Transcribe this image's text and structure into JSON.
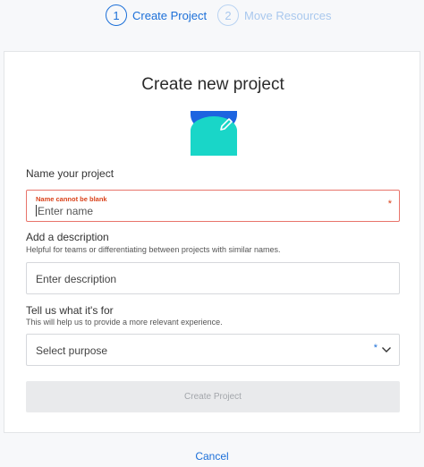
{
  "stepper": {
    "steps": [
      {
        "number": "1",
        "label": "Create Project"
      },
      {
        "number": "2",
        "label": "Move Resources"
      }
    ]
  },
  "card": {
    "title": "Create new project",
    "name_field": {
      "label": "Name your project",
      "error": "Name cannot be blank",
      "placeholder": "Enter name",
      "required_marker": "*"
    },
    "description_field": {
      "label": "Add a description",
      "helper": "Helpful for teams or differentiating between projects with similar names.",
      "placeholder": "Enter description"
    },
    "purpose_field": {
      "label": "Tell us what it's for",
      "helper": "This will help us to provide a more relevant experience.",
      "selected": "Select purpose",
      "required_marker": "*"
    },
    "create_button": "Create Project"
  },
  "cancel_label": "Cancel",
  "colors": {
    "accent": "#1b6fd8",
    "error": "#d9421b",
    "logo_blue": "#1d64e0",
    "logo_teal": "#19d6c8"
  },
  "icons": [
    "project-logo-icon",
    "pencil-icon",
    "chevron-down-icon"
  ]
}
